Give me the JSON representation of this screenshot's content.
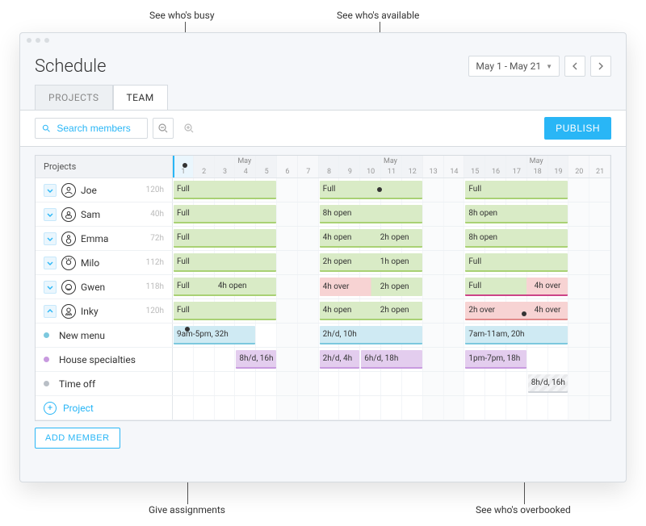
{
  "annotations": {
    "busy": "See who's busy",
    "available": "See who's available",
    "assignments": "Give assignments",
    "overbooked": "See who's overbooked"
  },
  "header": {
    "page_title": "Schedule",
    "date_range": "May 1 - May 21"
  },
  "tabs": {
    "projects": "PROJECTS",
    "team": "TEAM"
  },
  "toolbar": {
    "search_placeholder": "Search members",
    "publish": "PUBLISH"
  },
  "grid": {
    "name_header": "Projects",
    "month_label": "May",
    "today_index": 0,
    "days": [
      1,
      2,
      3,
      4,
      5,
      6,
      7,
      8,
      9,
      10,
      11,
      12,
      13,
      14,
      15,
      16,
      17,
      18,
      19,
      20,
      21
    ],
    "weekend_indices": [
      5,
      6,
      12,
      13,
      19,
      20
    ]
  },
  "members": [
    {
      "name": "Joe",
      "hours": "120h",
      "bars": [
        {
          "start": 0,
          "span": 5,
          "cls": "full",
          "labels": [
            {
              "t": "Full",
              "at": 0
            }
          ]
        },
        {
          "start": 7,
          "span": 5,
          "cls": "full",
          "labels": [
            {
              "t": "Full",
              "at": 0
            }
          ]
        },
        {
          "start": 14,
          "span": 5,
          "cls": "full",
          "labels": [
            {
              "t": "Full",
              "at": 0
            }
          ]
        }
      ]
    },
    {
      "name": "Sam",
      "hours": "40h",
      "bars": [
        {
          "start": 0,
          "span": 5,
          "cls": "full",
          "labels": [
            {
              "t": "Full",
              "at": 0
            }
          ]
        },
        {
          "start": 7,
          "span": 5,
          "cls": "open",
          "labels": [
            {
              "t": "8h open",
              "at": 0
            }
          ]
        },
        {
          "start": 14,
          "span": 5,
          "cls": "open",
          "labels": [
            {
              "t": "8h open",
              "at": 0
            }
          ]
        }
      ]
    },
    {
      "name": "Emma",
      "hours": "72h",
      "bars": [
        {
          "start": 0,
          "span": 5,
          "cls": "full",
          "labels": [
            {
              "t": "Full",
              "at": 0
            }
          ]
        },
        {
          "start": 7,
          "span": 5,
          "cls": "open",
          "labels": [
            {
              "t": "4h open",
              "at": 0
            },
            {
              "t": "2h open",
              "at": 56
            }
          ]
        },
        {
          "start": 14,
          "span": 5,
          "cls": "open",
          "labels": [
            {
              "t": "8h open",
              "at": 0
            }
          ]
        }
      ]
    },
    {
      "name": "Milo",
      "hours": "112h",
      "bars": [
        {
          "start": 0,
          "span": 5,
          "cls": "full",
          "labels": [
            {
              "t": "Full",
              "at": 0
            }
          ]
        },
        {
          "start": 7,
          "span": 5,
          "cls": "open",
          "labels": [
            {
              "t": "2h open",
              "at": 0
            },
            {
              "t": "1h open",
              "at": 56
            }
          ]
        },
        {
          "start": 14,
          "span": 5,
          "cls": "full",
          "labels": [
            {
              "t": "Full",
              "at": 0
            }
          ]
        }
      ]
    },
    {
      "name": "Gwen",
      "hours": "118h",
      "bars": [
        {
          "start": 0,
          "span": 5,
          "cls": "full",
          "labels": [
            {
              "t": "Full",
              "at": 0
            },
            {
              "t": "4h open",
              "at": 40
            }
          ]
        },
        {
          "start": 7,
          "span": 5,
          "cls": "mixed-red-green",
          "labels": [
            {
              "t": "4h over",
              "at": 0
            },
            {
              "t": "2h open",
              "at": 56
            }
          ]
        },
        {
          "start": 14,
          "span": 5,
          "cls": "mixed-green-red",
          "labels": [
            {
              "t": "Full",
              "at": 0
            },
            {
              "t": "4h over",
              "at": 64
            }
          ]
        }
      ]
    },
    {
      "name": "Inky",
      "hours": "120h",
      "expanded": true,
      "bars": [
        {
          "start": 0,
          "span": 5,
          "cls": "full",
          "labels": [
            {
              "t": "Full",
              "at": 0
            }
          ]
        },
        {
          "start": 7,
          "span": 5,
          "cls": "open",
          "labels": [
            {
              "t": "4h open",
              "at": 0
            },
            {
              "t": "2h open",
              "at": 56
            }
          ]
        },
        {
          "start": 14,
          "span": 5,
          "cls": "over",
          "labels": [
            {
              "t": "2h over",
              "at": 0
            },
            {
              "t": "4h over",
              "at": 64
            }
          ]
        }
      ]
    }
  ],
  "project_rows": [
    {
      "name": "New menu",
      "dot": "c-menu",
      "bars": [
        {
          "start": 0,
          "span": 4,
          "cls": "menu",
          "labels": [
            {
              "t": "9am-5pm, 32h",
              "at": 0
            }
          ]
        },
        {
          "start": 7,
          "span": 5,
          "cls": "menu",
          "labels": [
            {
              "t": "2h/d, 10h",
              "at": 0
            }
          ]
        },
        {
          "start": 14,
          "span": 5,
          "cls": "menu",
          "labels": [
            {
              "t": "7am-11am, 20h",
              "at": 0
            }
          ]
        }
      ]
    },
    {
      "name": "House specialties",
      "dot": "c-house",
      "bars": [
        {
          "start": 3,
          "span": 2,
          "cls": "house",
          "labels": [
            {
              "t": "8h/d, 16h",
              "at": 0
            }
          ]
        },
        {
          "start": 7,
          "span": 2,
          "cls": "house",
          "labels": [
            {
              "t": "2h/d, 4h",
              "at": 0
            }
          ]
        },
        {
          "start": 9,
          "span": 3,
          "cls": "house",
          "labels": [
            {
              "t": "6h/d, 18h",
              "at": 0
            }
          ]
        },
        {
          "start": 14,
          "span": 3,
          "cls": "house",
          "labels": [
            {
              "t": "1pm-7pm, 18h",
              "at": 0
            }
          ]
        }
      ]
    },
    {
      "name": "Time off",
      "dot": "c-time",
      "bars": [
        {
          "start": 17,
          "span": 2,
          "cls": "timeoff",
          "labels": [
            {
              "t": "8h/d, 16h",
              "at": 0
            }
          ]
        }
      ]
    }
  ],
  "add_project": "Project",
  "add_member": "ADD MEMBER"
}
